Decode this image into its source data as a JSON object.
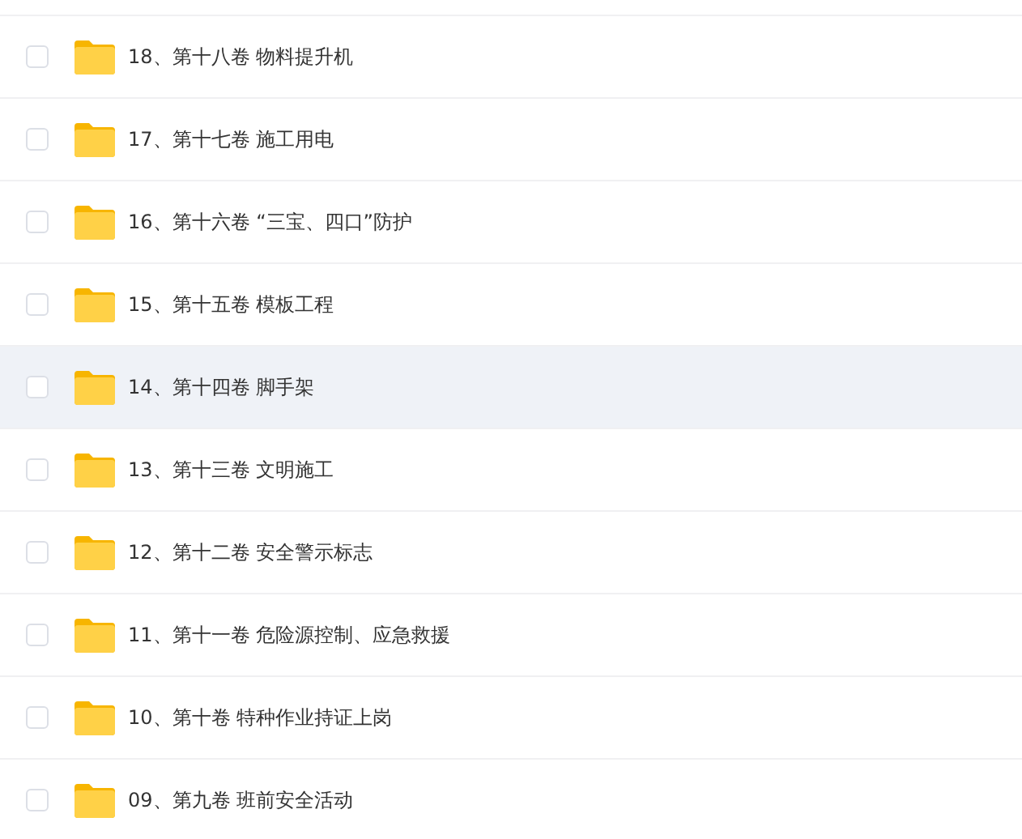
{
  "files": [
    {
      "name": "18、第十八卷 物料提升机",
      "checked": false,
      "hovered": false
    },
    {
      "name": "17、第十七卷 施工用电",
      "checked": false,
      "hovered": false
    },
    {
      "name": "16、第十六卷 “三宝、四口”防护",
      "checked": false,
      "hovered": false
    },
    {
      "name": "15、第十五卷 模板工程",
      "checked": false,
      "hovered": false
    },
    {
      "name": "14、第十四卷 脚手架",
      "checked": false,
      "hovered": true
    },
    {
      "name": "13、第十三卷 文明施工",
      "checked": false,
      "hovered": false
    },
    {
      "name": "12、第十二卷 安全警示标志",
      "checked": false,
      "hovered": false
    },
    {
      "name": "11、第十一卷 危险源控制、应急救援",
      "checked": false,
      "hovered": false
    },
    {
      "name": "10、第十卷 特种作业持证上岗",
      "checked": false,
      "hovered": false
    },
    {
      "name": "09、第九卷 班前安全活动",
      "checked": false,
      "hovered": false
    }
  ]
}
